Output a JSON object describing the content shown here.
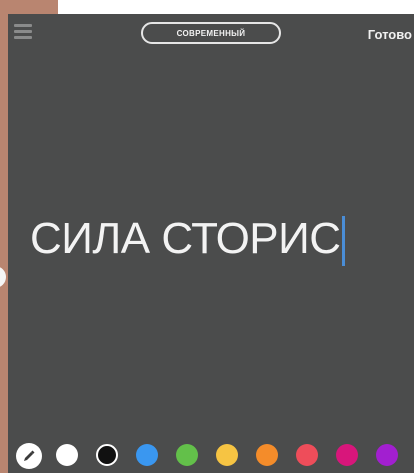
{
  "toolbar": {
    "style_label": "СОВРЕМЕННЫЙ",
    "done_label": "Готово"
  },
  "canvas": {
    "text": "СИЛА СТОРИС"
  },
  "colors": {
    "background": "#4b4c4c",
    "text": "#f3f3f3",
    "caret": "#4a8dd6"
  },
  "palette": [
    {
      "name": "white",
      "color": "#ffffff"
    },
    {
      "name": "black",
      "color": "#111111"
    },
    {
      "name": "blue",
      "color": "#3a97f0"
    },
    {
      "name": "green",
      "color": "#63c04a"
    },
    {
      "name": "yellow",
      "color": "#f6c443"
    },
    {
      "name": "orange",
      "color": "#f48c2a"
    },
    {
      "name": "red",
      "color": "#ee4d5a"
    },
    {
      "name": "pink",
      "color": "#d8167b"
    },
    {
      "name": "purple",
      "color": "#a21fd0"
    }
  ]
}
